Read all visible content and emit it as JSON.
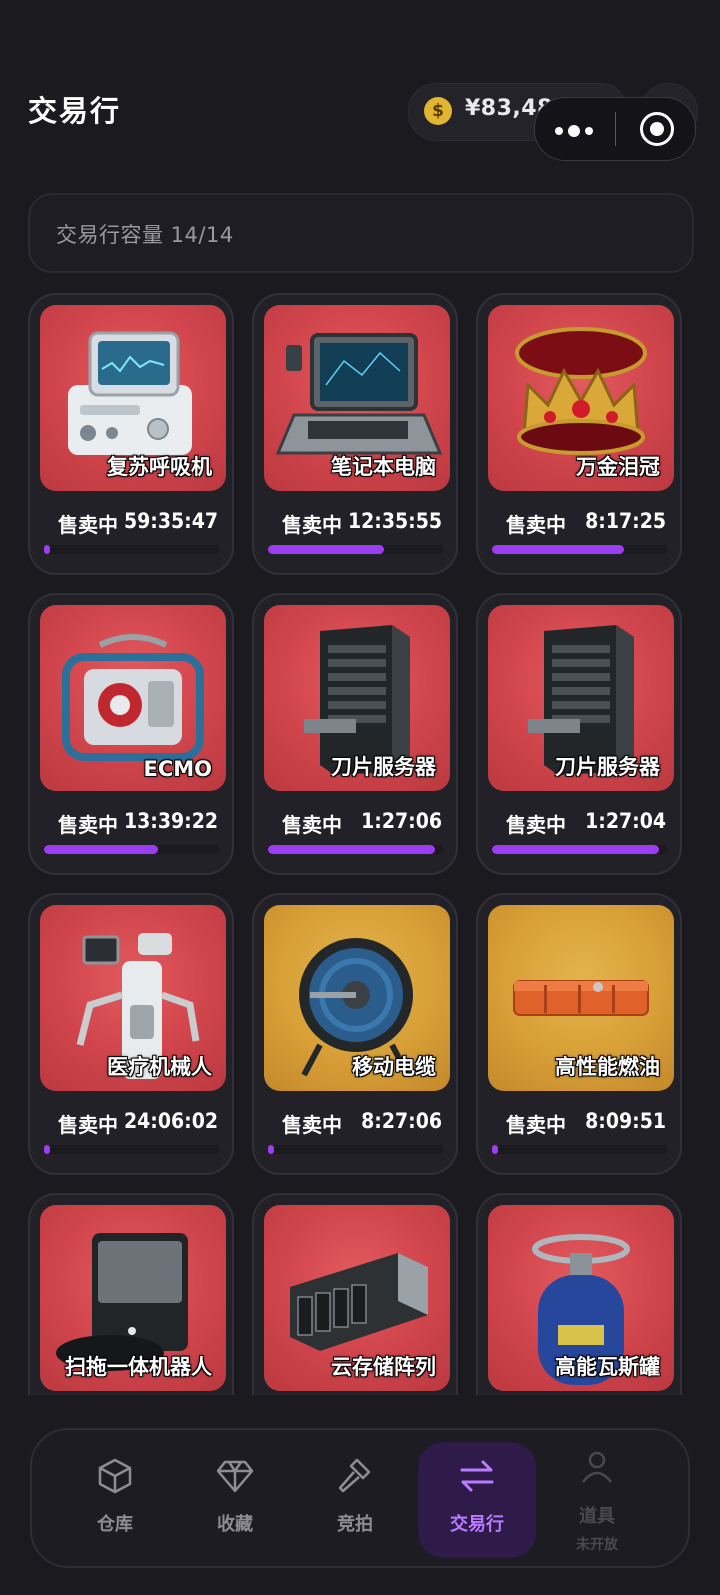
{
  "header": {
    "title": "交易行",
    "balance": "¥83,481,603",
    "coin_symbol": "$",
    "add_symbol": "+"
  },
  "capacity": {
    "label": "交易行容量 14/14"
  },
  "listings": [
    {
      "name": "复苏呼吸机",
      "status": "售卖中",
      "timer": "59:35:47",
      "progress": 0.03,
      "bg": "red",
      "icon": "ventilator-icon"
    },
    {
      "name": "笔记本电脑",
      "status": "售卖中",
      "timer": "12:35:55",
      "progress": 0.66,
      "bg": "red",
      "icon": "laptop-icon"
    },
    {
      "name": "万金泪冠",
      "status": "售卖中",
      "timer": "8:17:25",
      "progress": 0.75,
      "bg": "red",
      "icon": "crown-icon"
    },
    {
      "name": "ECMO",
      "status": "售卖中",
      "timer": "13:39:22",
      "progress": 0.65,
      "bg": "red",
      "icon": "ecmo-machine-icon"
    },
    {
      "name": "刀片服务器",
      "status": "售卖中",
      "timer": "1:27:06",
      "progress": 0.95,
      "bg": "red",
      "icon": "server-rack-icon"
    },
    {
      "name": "刀片服务器",
      "status": "售卖中",
      "timer": "1:27:04",
      "progress": 0.95,
      "bg": "red",
      "icon": "server-rack-icon"
    },
    {
      "name": "医疗机械人",
      "status": "售卖中",
      "timer": "24:06:02",
      "progress": 0.03,
      "bg": "red",
      "icon": "medical-robot-icon"
    },
    {
      "name": "移动电缆",
      "status": "售卖中",
      "timer": "8:27:06",
      "progress": 0.03,
      "bg": "gold",
      "icon": "cable-reel-icon"
    },
    {
      "name": "高性能燃油",
      "status": "售卖中",
      "timer": "8:09:51",
      "progress": 0.03,
      "bg": "gold",
      "icon": "fuel-canister-icon"
    },
    {
      "name": "扫拖一体机器人",
      "status": "",
      "timer": "",
      "progress": 0,
      "bg": "red",
      "icon": "robot-vacuum-icon"
    },
    {
      "name": "云存储阵列",
      "status": "",
      "timer": "",
      "progress": 0,
      "bg": "red",
      "icon": "storage-array-icon"
    },
    {
      "name": "高能瓦斯罐",
      "status": "",
      "timer": "",
      "progress": 0,
      "bg": "red",
      "icon": "gas-canister-icon"
    }
  ],
  "tabbar": {
    "tabs": [
      {
        "label": "仓库",
        "icon": "box-icon",
        "active": false
      },
      {
        "label": "收藏",
        "icon": "diamond-icon",
        "active": false
      },
      {
        "label": "竞拍",
        "icon": "gavel-icon",
        "active": false
      },
      {
        "label": "交易行",
        "icon": "exchange-arrows-icon",
        "active": true
      },
      {
        "label": "道具",
        "sub": "未开放",
        "icon": "person-icon",
        "active": false
      }
    ]
  },
  "colors": {
    "accent": "#9b3df0",
    "card_red": "#cf444b",
    "card_gold": "#d79f36",
    "background": "#1b1a1f"
  }
}
